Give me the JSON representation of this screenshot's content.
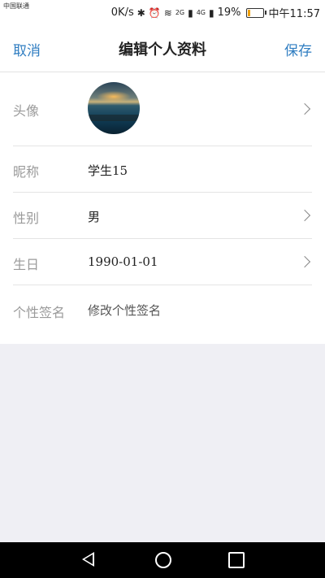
{
  "status": {
    "carrier": "中国联通",
    "speed": "0K/s",
    "signal_1": "2G",
    "signal_2": "4G",
    "battery": "19%",
    "time": "中午11:57",
    "battery_level": 0.19
  },
  "header": {
    "cancel_label": "取消",
    "title": "编辑个人资料",
    "save_label": "保存"
  },
  "form": {
    "avatar_label": "头像",
    "nickname_label": "昵称",
    "nickname_value": "学生15",
    "gender_label": "性别",
    "gender_value": "男",
    "birthday_label": "生日",
    "birthday_value": "1990-01-01",
    "signature_label": "个性签名",
    "signature_placeholder": "修改个性签名"
  },
  "colors": {
    "accent": "#2f7dc1",
    "background": "#efeff4"
  }
}
